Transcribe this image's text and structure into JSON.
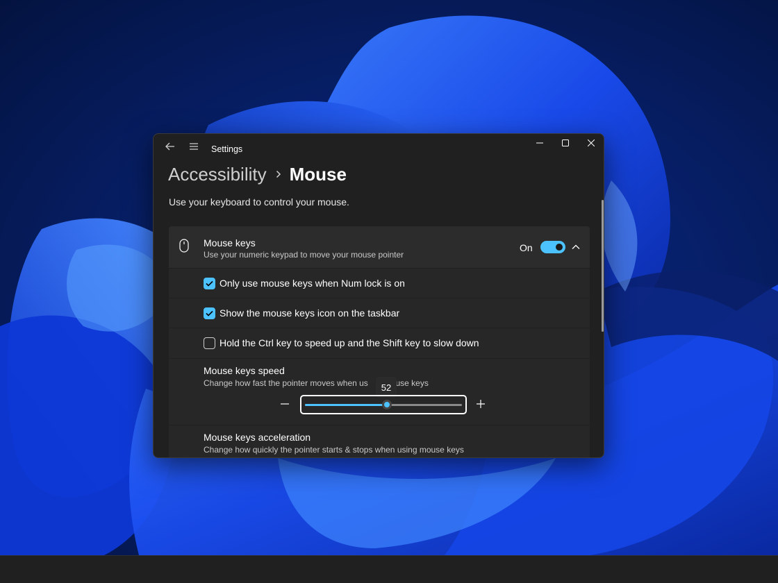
{
  "window": {
    "title": "Settings"
  },
  "breadcrumb": {
    "parent": "Accessibility",
    "separator": "›",
    "current": "Mouse"
  },
  "page_description": "Use your keyboard to control your mouse.",
  "mouse_keys": {
    "title": "Mouse keys",
    "description": "Use your numeric keypad to move your mouse pointer",
    "toggle_state": "On",
    "toggle_on": true,
    "expanded": true
  },
  "options": [
    {
      "label": "Only use mouse keys when Num lock is on",
      "checked": true
    },
    {
      "label": "Show the mouse keys icon on the taskbar",
      "checked": true
    },
    {
      "label": "Hold the Ctrl key to speed up and the Shift key to slow down",
      "checked": false
    }
  ],
  "speed": {
    "title": "Mouse keys speed",
    "description_before": "Change how fast the pointer moves when us",
    "description_after": "ouse keys",
    "value": 52,
    "value_label": "52",
    "min": 0,
    "max": 100
  },
  "acceleration": {
    "title": "Mouse keys acceleration",
    "description": "Change how quickly the pointer starts & stops when using mouse keys"
  },
  "icons": {
    "back": "back-arrow-icon",
    "menu": "hamburger-menu-icon",
    "minimize": "minimize-icon",
    "maximize": "maximize-icon",
    "close": "close-icon",
    "mouse": "mouse-icon",
    "chevron": "chevron-up-icon",
    "minus": "minus-icon",
    "plus": "plus-icon",
    "check": "checkmark-icon"
  },
  "colors": {
    "accent": "#4cc2ff",
    "window_bg": "#202020",
    "card_bg": "#2b2b2b",
    "taskbar_bg": "#202020"
  }
}
